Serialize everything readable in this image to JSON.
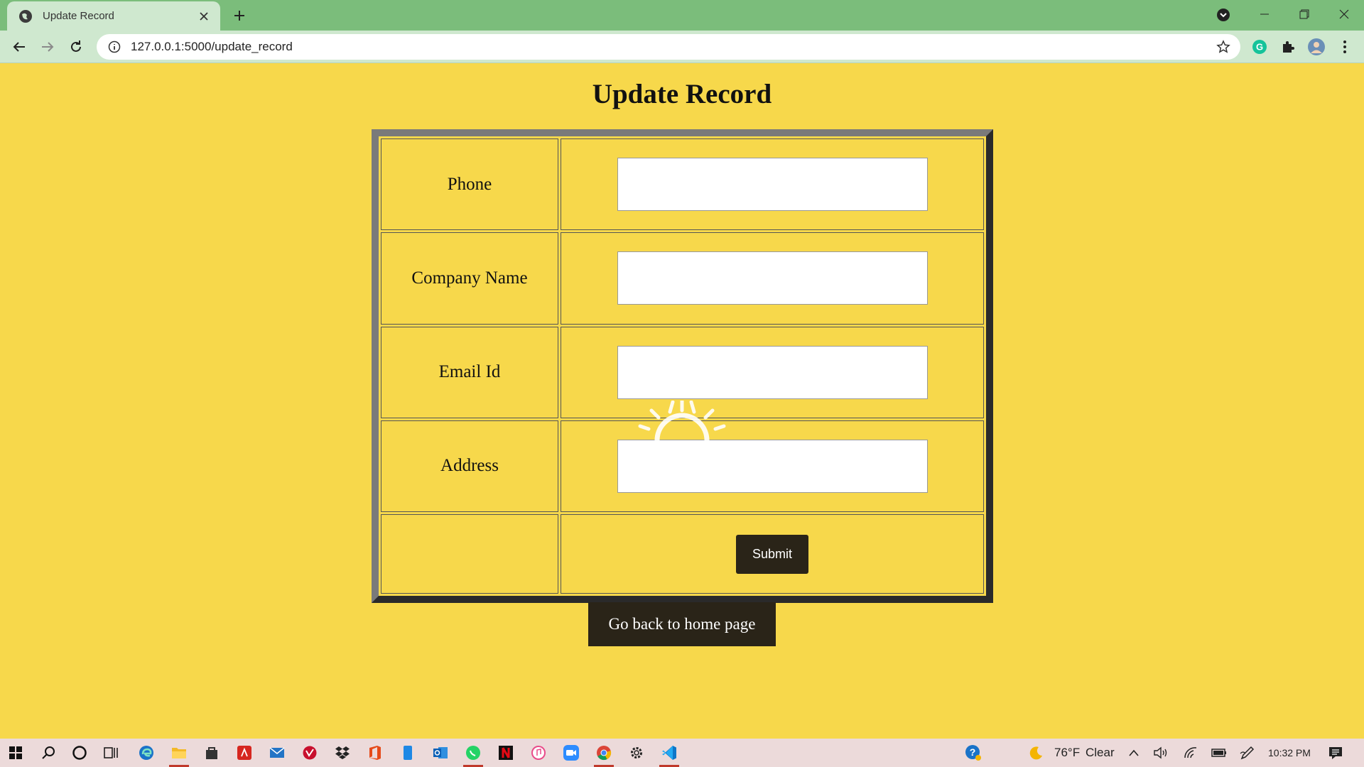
{
  "browser": {
    "tab_title": "Update Record",
    "url": "127.0.0.1:5000/update_record"
  },
  "page": {
    "title": "Update Record",
    "fields": [
      {
        "label": "Phone",
        "value": ""
      },
      {
        "label": "Company Name",
        "value": ""
      },
      {
        "label": "Email Id",
        "value": ""
      },
      {
        "label": "Address",
        "value": ""
      }
    ],
    "submit_label": "Submit",
    "home_link": "Go back to home page"
  },
  "taskbar": {
    "weather_temp": "76°F",
    "weather_cond": "Clear",
    "time": "10:32 PM"
  },
  "colors": {
    "page_bg": "#f7d84b",
    "button_bg": "#2a2418",
    "tabbar_bg": "#7bbd7b"
  }
}
